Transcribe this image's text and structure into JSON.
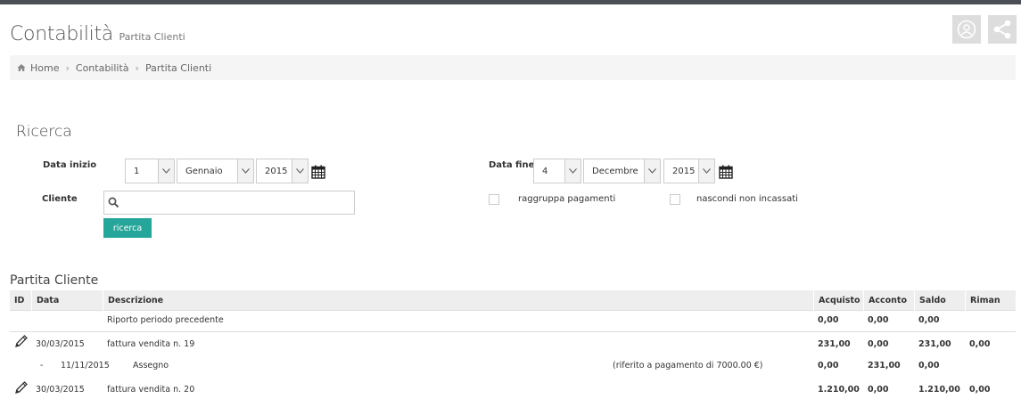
{
  "header": {
    "title": "Contabilità",
    "subtitle": "Partita Clienti",
    "buttons": [
      {
        "icon": "user-circle-icon"
      },
      {
        "icon": "share-icon"
      }
    ]
  },
  "breadcrumb": {
    "items": [
      "Home",
      "Contabilità",
      "Partita Clienti"
    ]
  },
  "search": {
    "title": "Ricerca",
    "start_label": "Data inizio",
    "start_day": "1",
    "start_month": "Gennaio",
    "start_year": "2015",
    "end_label": "Data fine",
    "end_day": "4",
    "end_month": "Decembre",
    "end_year": "2015",
    "client_label": "Cliente",
    "client_value": "",
    "button_label": "ricerca",
    "group_payments_label": "raggruppa pagamenti",
    "hide_uncollected_label": "nascondi non incassati"
  },
  "table": {
    "title": "Partita Cliente",
    "headers": [
      "ID",
      "Data",
      "Descrizione",
      "Acquisto",
      "Acconto",
      "Saldo",
      "Riman"
    ],
    "rows": [
      {
        "id": "",
        "date": "",
        "desc": "Riporto periodo precedente",
        "note": "",
        "acquisto": "0,00",
        "acconto": "0,00",
        "saldo": "0,00",
        "riman": ""
      },
      {
        "id": "edit",
        "date": "30/03/2015",
        "desc": "fattura vendita n. 19",
        "note": "",
        "acquisto": "231,00",
        "acconto": "0,00",
        "saldo": "231,00",
        "riman": "0,00"
      },
      {
        "id": "-",
        "date": "11/11/2015",
        "desc": "Assegno",
        "note": "(riferito a pagamento di 7000.00 €)",
        "acquisto": "0,00",
        "acconto": "231,00",
        "saldo": "0,00",
        "riman": ""
      },
      {
        "id": "edit",
        "date": "30/03/2015",
        "desc": "fattura vendita n. 20",
        "note": "",
        "acquisto": "1.210,00",
        "acconto": "0,00",
        "saldo": "1.210,00",
        "riman": "0,00"
      }
    ]
  },
  "colors": {
    "accent": "#26a69a",
    "topbar": "#4a4f55"
  }
}
